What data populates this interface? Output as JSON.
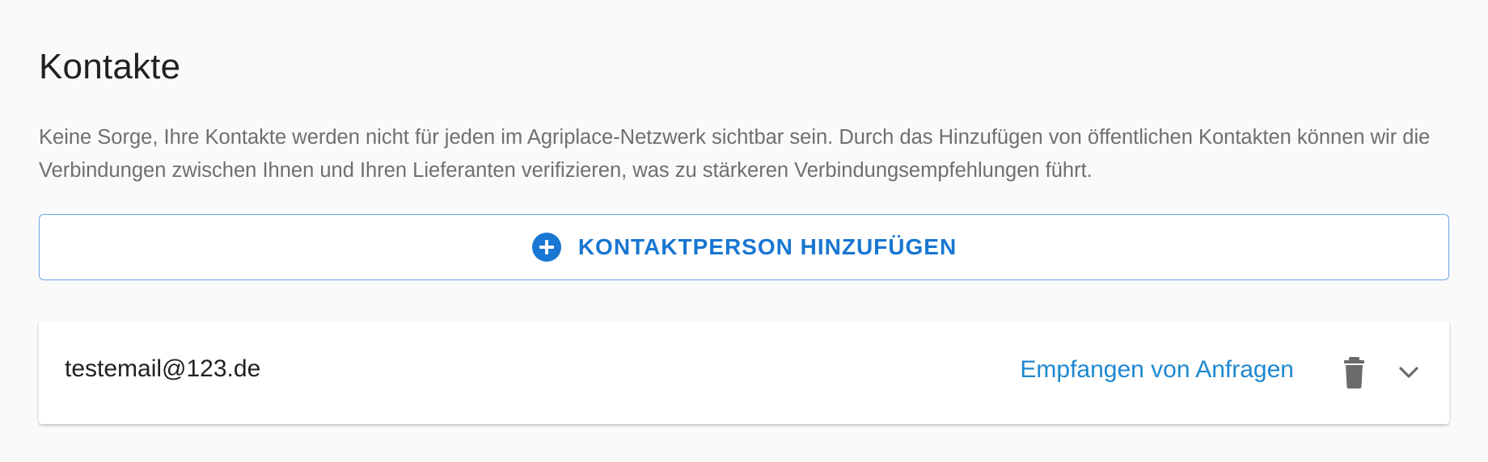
{
  "header": {
    "title": "Kontakte"
  },
  "intro": {
    "text": "Keine Sorge, Ihre Kontakte werden nicht für jeden im Agriplace-Netzwerk sichtbar sein. Durch das Hinzufügen von öffentlichen Kontakten können wir die Verbindungen zwischen Ihnen und Ihren Lieferanten verifizieren, was zu stärkeren Verbindungsempfehlungen führt."
  },
  "add_contact_button": {
    "label": "KONTAKTPERSON HINZUFÜGEN",
    "icon": "plus-circle-icon"
  },
  "contacts": [
    {
      "email": "testemail@123.de",
      "role_label": "Empfangen von Anfragen",
      "delete_icon": "trash-icon",
      "expand_icon": "chevron-down-icon"
    }
  ],
  "colors": {
    "accent": "#1976d2",
    "link": "#1e88d0",
    "button_border": "#6aa9e6",
    "text_primary": "#212121",
    "text_secondary": "#6f6f6f",
    "icon_gray": "#6b6b6b",
    "background": "#fafafa"
  }
}
